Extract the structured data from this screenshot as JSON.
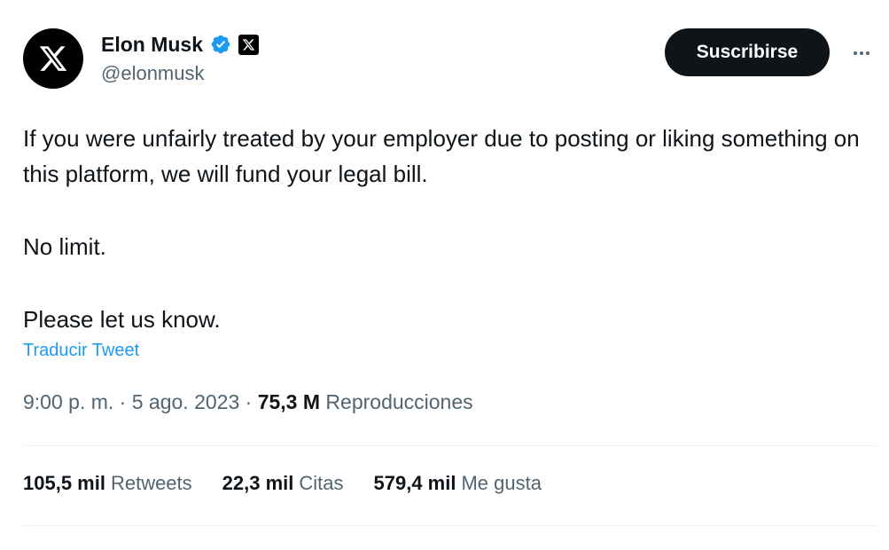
{
  "author": {
    "display_name": "Elon Musk",
    "handle": "@elonmusk",
    "verified_color": "#1d9bf0",
    "avatar_icon": "x-logo-icon",
    "affiliation_icon": "x-badge-icon"
  },
  "actions": {
    "subscribe_label": "Suscribirse",
    "more_icon": "more-dots-icon"
  },
  "tweet": {
    "paragraphs": [
      "If you were unfairly treated by your employer due to posting or liking something on this platform, we will fund your legal bill.",
      "No limit.",
      "Please let us know."
    ],
    "translate_label": "Traducir Tweet"
  },
  "meta": {
    "time": "9:00 p. m.",
    "separator": "·",
    "date": "5 ago. 2023",
    "views_count": "75,3 M",
    "views_label": "Reproducciones"
  },
  "stats": {
    "retweets_count": "105,5 mil",
    "retweets_label": "Retweets",
    "quotes_count": "22,3 mil",
    "quotes_label": "Citas",
    "likes_count": "579,4 mil",
    "likes_label": "Me gusta"
  },
  "colors": {
    "primary_text": "#0f1419",
    "secondary_text": "#536471",
    "link": "#1d9bf0",
    "divider": "#eff3f4"
  }
}
